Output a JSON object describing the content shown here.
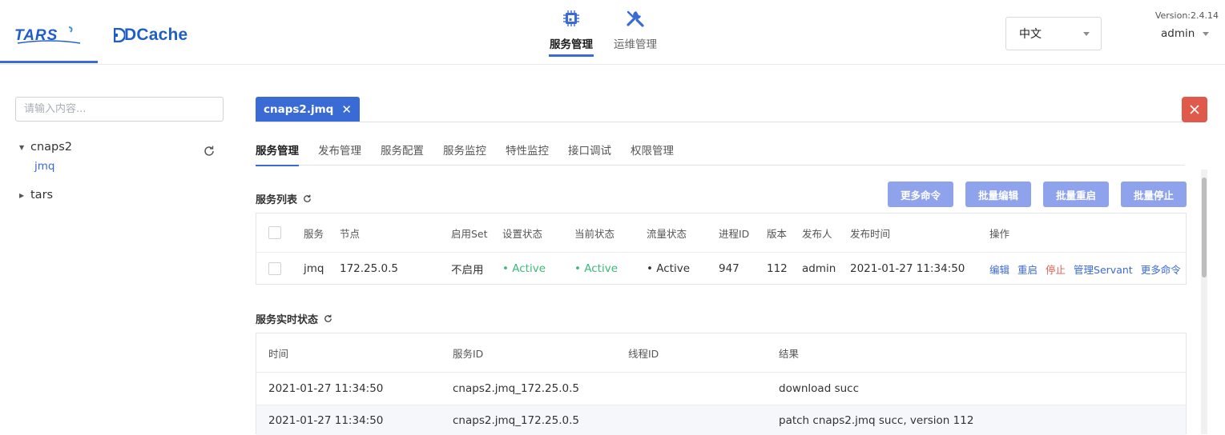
{
  "header": {
    "logo_tars": "TARS",
    "logo_dcache": "DCache",
    "nav": [
      {
        "label": "服务管理",
        "icon": "chip-icon",
        "active": true
      },
      {
        "label": "运维管理",
        "icon": "wrench-icon",
        "active": false
      }
    ],
    "language": "中文",
    "version": "Version:2.4.14",
    "user": "admin"
  },
  "sidebar": {
    "search_placeholder": "请输入内容...",
    "tree": [
      {
        "label": "cnaps2",
        "expanded": true,
        "children": [
          "jmq"
        ]
      },
      {
        "label": "tars",
        "expanded": false,
        "children": []
      }
    ]
  },
  "main": {
    "open_tab": "cnaps2.jmq",
    "subtabs": [
      "服务管理",
      "发布管理",
      "服务配置",
      "服务监控",
      "特性监控",
      "接口调试",
      "权限管理"
    ],
    "service_list": {
      "title": "服务列表",
      "buttons": [
        "更多命令",
        "批量编辑",
        "批量重启",
        "批量停止"
      ],
      "columns": [
        "服务",
        "节点",
        "启用Set",
        "设置状态",
        "当前状态",
        "流量状态",
        "进程ID",
        "版本",
        "发布人",
        "发布时间",
        "操作"
      ],
      "rows": [
        {
          "service": "jmq",
          "node": "172.25.0.5",
          "set": "不启用",
          "setting_state": "• Active",
          "present_state": "• Active",
          "flow_state": "• Active",
          "pid": "947",
          "version": "112",
          "publisher": "admin",
          "publish_time": "2021-01-27 11:34:50",
          "ops": [
            "编辑",
            "重启",
            "停止",
            "管理Servant",
            "更多命令"
          ]
        }
      ]
    },
    "realtime_status": {
      "title": "服务实时状态",
      "columns": [
        "时间",
        "服务ID",
        "线程ID",
        "结果"
      ],
      "rows": [
        {
          "time": "2021-01-27 11:34:50",
          "service_id": "cnaps2.jmq_172.25.0.5",
          "thread_id": "",
          "result": "download succ"
        },
        {
          "time": "2021-01-27 11:34:50",
          "service_id": "cnaps2.jmq_172.25.0.5",
          "thread_id": "",
          "result": "patch cnaps2.jmq succ, version 112"
        }
      ]
    }
  },
  "colors": {
    "accent": "#3a6ad4",
    "button": "#8fa2ec",
    "active_green": "#3cb878",
    "danger": "#e05a4c"
  }
}
